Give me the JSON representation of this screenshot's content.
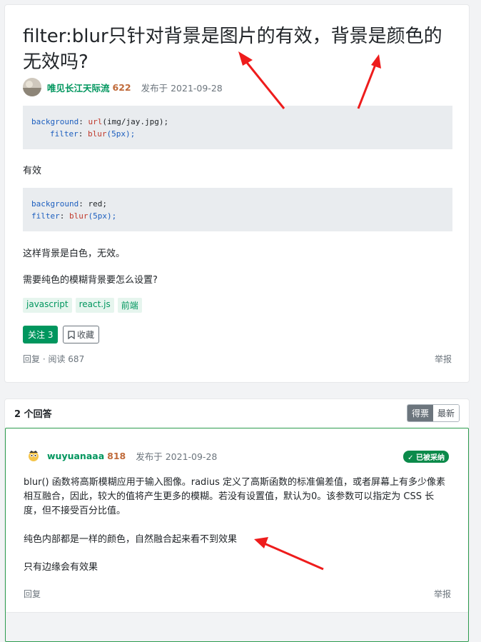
{
  "question": {
    "title": "filter:blur只针对背景是图片的有效，背景是颜色的无效吗?",
    "author": "唯见长江天际流",
    "reputation": "622",
    "published": "发布于 2021-09-28",
    "code1_line1_prop": "background",
    "code1_line1_fn": "url",
    "code1_line1_arg": "(img/jay.jpg);",
    "code1_line2_prop": "filter",
    "code1_line2_fn": "blur",
    "code1_line2_arg": "(5px);",
    "para1": "有效",
    "code2_line1_prop": "background",
    "code2_line1_val": "red;",
    "code2_line2_prop": "filter",
    "code2_line2_fn": "blur",
    "code2_line2_arg": "(5px);",
    "para2": "这样背景是白色，无效。",
    "para3": "需要纯色的模糊背景要怎么设置?",
    "tags": [
      "javascript",
      "react.js",
      "前端"
    ],
    "follow_label": "关注 3",
    "favorite_label": "收藏",
    "reply_label": "回复",
    "reads_label": "阅读 687",
    "report_label": "举报"
  },
  "answers": {
    "header": "2 个回答",
    "sort_votes": "得票",
    "sort_latest": "最新",
    "author": "wuyuanaaa",
    "reputation": "818",
    "published": "发布于 2021-09-28",
    "accepted_label": "已被采纳",
    "text1": "blur() 函数将高斯模糊应用于输入图像。radius 定义了高斯函数的标准偏差值，或者屏幕上有多少像素相互融合，因此，较大的值将产生更多的模糊。若没有设置值，默认为0。该参数可以指定为 CSS 长度，但不接受百分比值。",
    "text2": "纯色内部都是一样的颜色，自然融合起来看不到效果",
    "text3": "只有边缘会有效果",
    "reply_label": "回复",
    "report_label": "举报"
  },
  "colors": {
    "brand_green": "#00965e",
    "arrow_red": "#ee1c1c"
  }
}
